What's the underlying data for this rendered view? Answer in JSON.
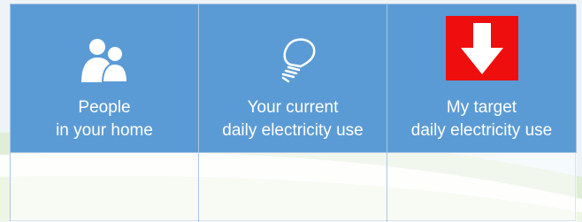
{
  "columns": [
    {
      "icon": "people-icon",
      "line1": "People",
      "line2": "in your home"
    },
    {
      "icon": "lightbulb-icon",
      "line1": "Your current",
      "line2": "daily electricity use"
    },
    {
      "icon": "down-arrow-icon",
      "line1": "My target",
      "line2": "daily electricity use"
    }
  ],
  "colors": {
    "header_bg": "#5b9bd5",
    "arrow_box": "#ee0e0e",
    "text": "#ffffff"
  }
}
